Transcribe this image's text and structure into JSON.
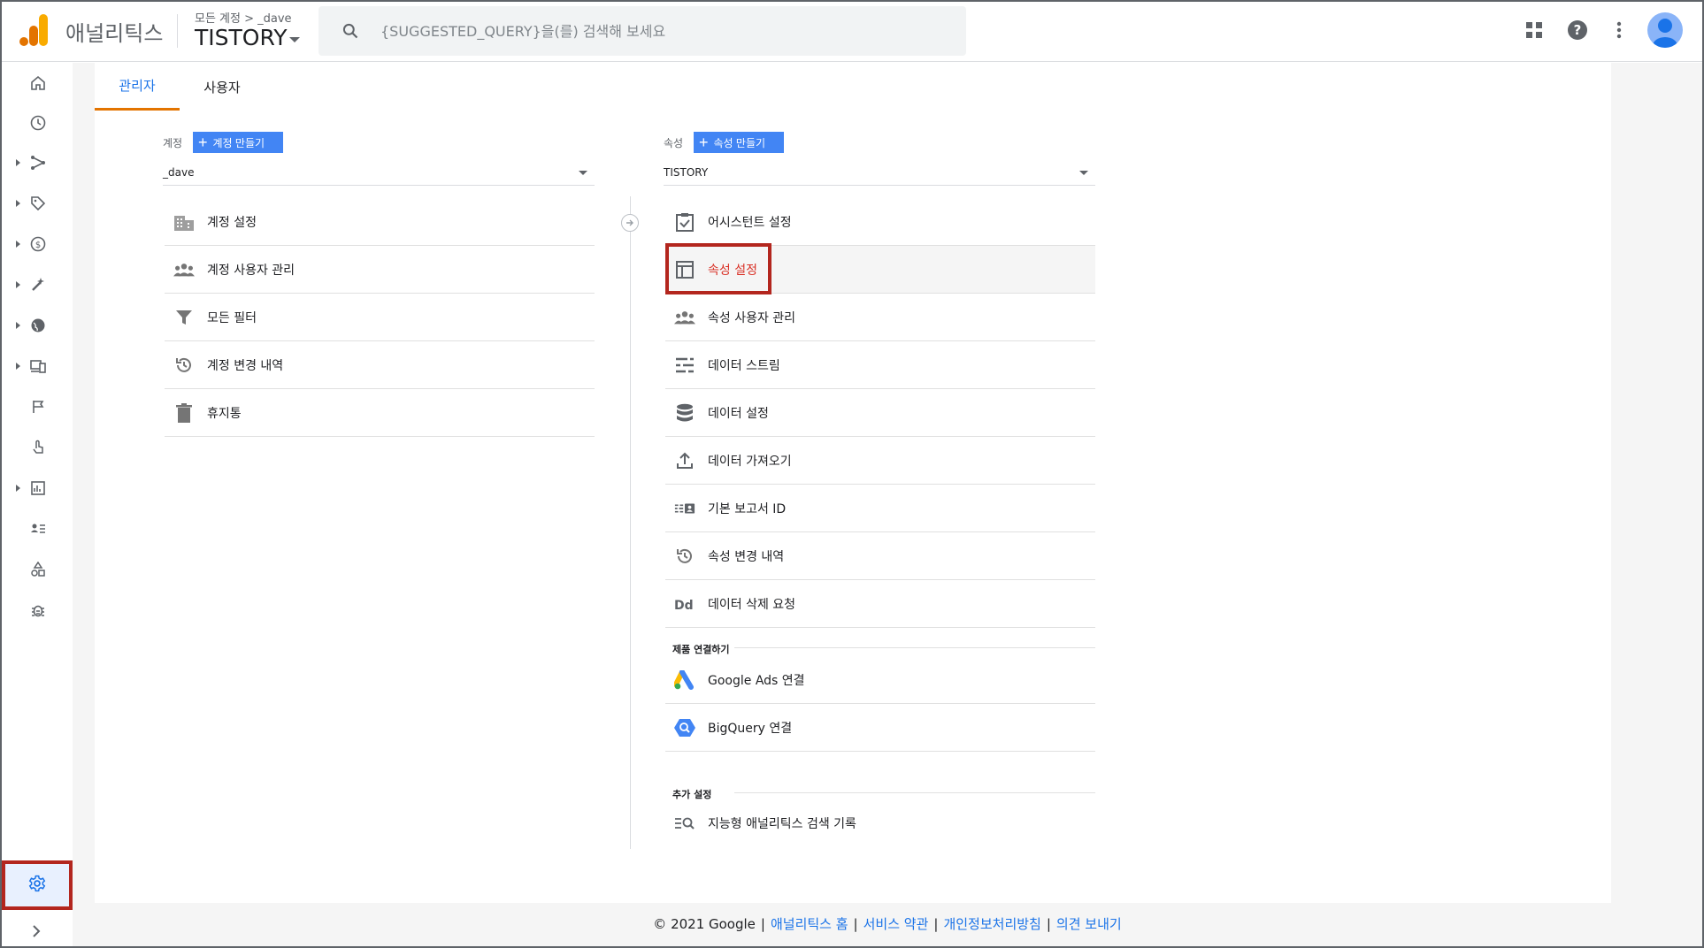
{
  "header": {
    "app_name": "애널리틱스",
    "breadcrumb": "모든 계정  >  _dave",
    "property": "TISTORY",
    "search_placeholder": "{SUGGESTED_QUERY}을(를) 검색해 보세요"
  },
  "tabs": [
    {
      "label": "관리자",
      "active": true
    },
    {
      "label": "사용자",
      "active": false
    }
  ],
  "account": {
    "label": "계정",
    "create_label": "계정 만들기",
    "selected": "_dave",
    "items": [
      {
        "label": "계정 설정",
        "icon": "building-icon"
      },
      {
        "label": "계정 사용자 관리",
        "icon": "people-icon"
      },
      {
        "label": "모든 필터",
        "icon": "filter-icon"
      },
      {
        "label": "계정 변경 내역",
        "icon": "history-icon"
      },
      {
        "label": "휴지통",
        "icon": "trash-icon"
      }
    ]
  },
  "property": {
    "label": "속성",
    "create_label": "속성 만들기",
    "selected": "TISTORY",
    "items": [
      {
        "label": "어시스턴트 설정",
        "icon": "checklist-icon"
      },
      {
        "label": "속성 설정",
        "icon": "web-layout-icon",
        "active": true
      },
      {
        "label": "속성 사용자 관리",
        "icon": "people-icon"
      },
      {
        "label": "데이터 스트림",
        "icon": "stream-icon"
      },
      {
        "label": "데이터 설정",
        "icon": "database-icon"
      },
      {
        "label": "데이터 가져오기",
        "icon": "upload-icon"
      },
      {
        "label": "기본 보고서 ID",
        "icon": "report-id-icon"
      },
      {
        "label": "속성 변경 내역",
        "icon": "history-icon"
      },
      {
        "label": "데이터 삭제 요청",
        "icon": "data-delete-icon"
      }
    ],
    "product_links_title": "제품 연결하기",
    "product_links": [
      {
        "label": "Google Ads 연결",
        "icon": "google-ads-icon"
      },
      {
        "label": "BigQuery 연결",
        "icon": "bigquery-icon"
      }
    ],
    "additional_title": "추가 설정",
    "additional": [
      {
        "label": "지능형 애널리틱스 검색 기록",
        "icon": "search-history-icon"
      }
    ],
    "active_highlight": "#d93025"
  },
  "footer": {
    "copyright": "© 2021 Google",
    "links": [
      "애널리틱스 홈",
      "서비스 약관",
      "개인정보처리방침",
      "의견 보내기"
    ]
  },
  "colors": {
    "accent": "#1a73e8",
    "tab_underline": "#e37400",
    "button": "#4285f4",
    "annotation_box": "#b3261e"
  }
}
